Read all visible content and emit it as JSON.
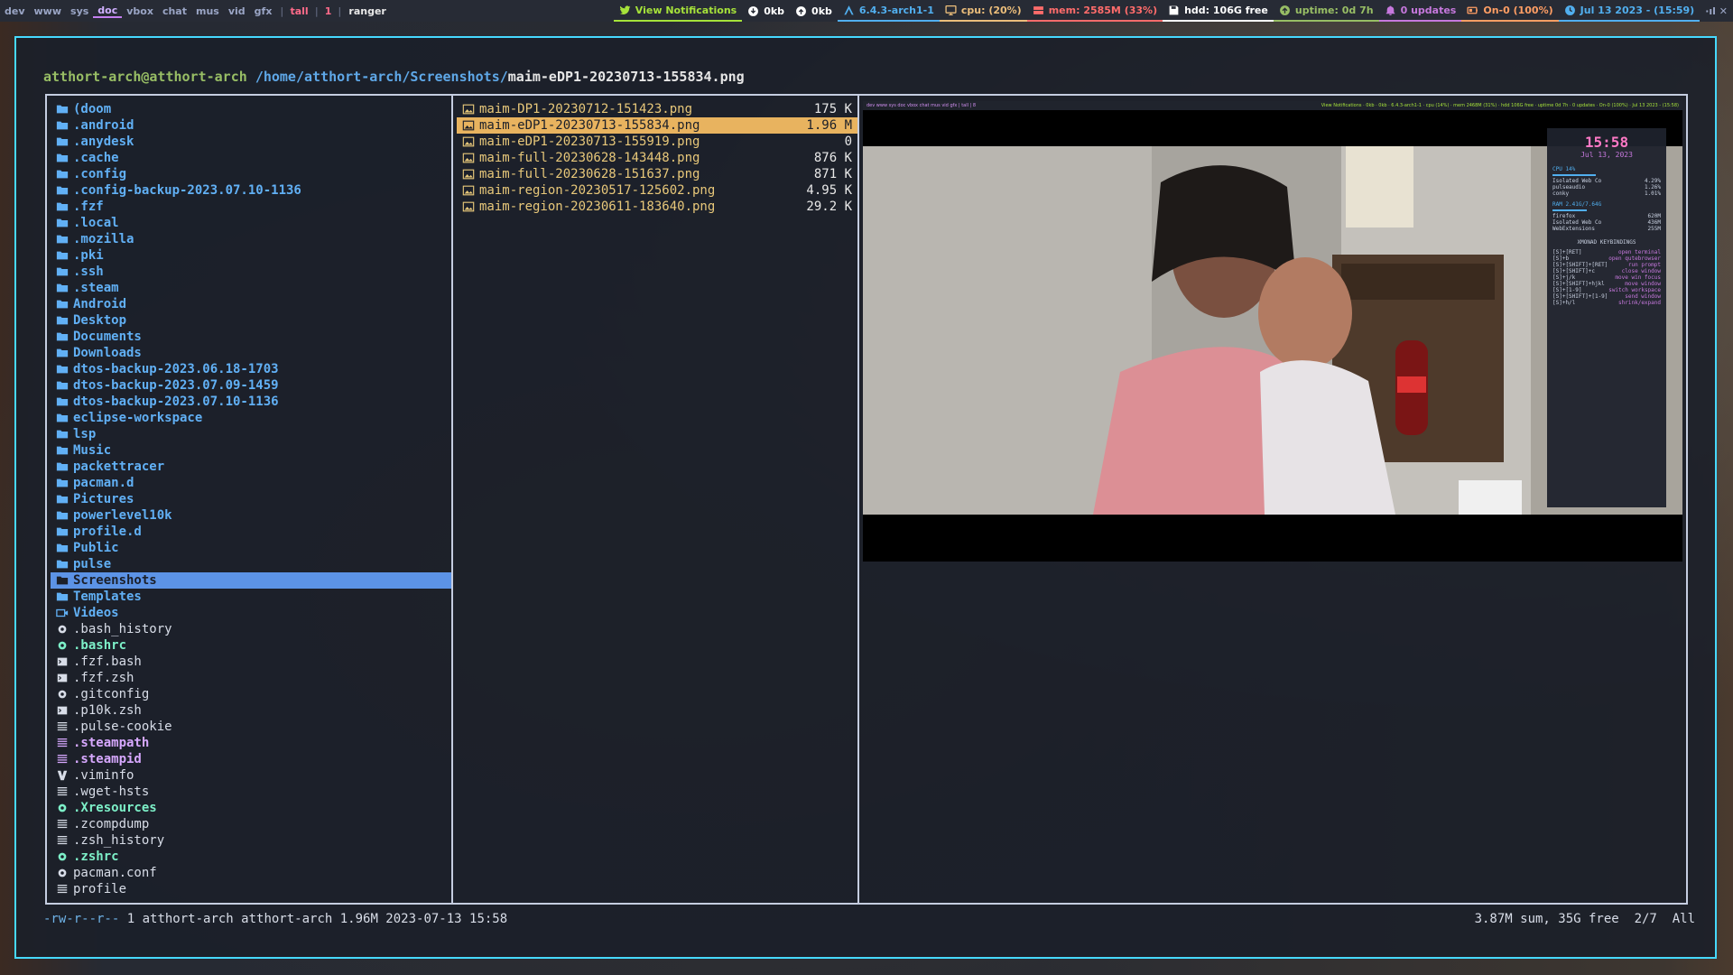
{
  "topbar": {
    "workspaces": [
      "dev",
      "www",
      "sys",
      "doc",
      "vbox",
      "chat",
      "mus",
      "vid",
      "gfx"
    ],
    "layout": "tall",
    "window_count": "1",
    "window_title": "ranger",
    "modules": {
      "notifications": "View Notifications",
      "net_down": "0kb",
      "net_up": "0kb",
      "kernel": "6.4.3-arch1-1",
      "cpu": "cpu: (20%)",
      "mem": "mem: 2585M (33%)",
      "hdd": "hdd: 106G free",
      "uptime": "uptime: 0d 7h",
      "updates": "0 updates",
      "battery": "On-0 (100%)",
      "clock": "Jul 13 2023 - (15:59)"
    },
    "tray": "·ıl ✕"
  },
  "terminal": {
    "host": "atthort-arch@atthort-arch",
    "dir": "/home/atthort-arch/Screenshots/",
    "file": "maim-eDP1-20230713-155834.png"
  },
  "left_pane": [
    {
      "name": "(doom",
      "type": "dir"
    },
    {
      "name": ".android",
      "type": "dir"
    },
    {
      "name": ".anydesk",
      "type": "dir"
    },
    {
      "name": ".cache",
      "type": "dir"
    },
    {
      "name": ".config",
      "type": "dir"
    },
    {
      "name": ".config-backup-2023.07.10-1136",
      "type": "dir"
    },
    {
      "name": ".fzf",
      "type": "dir"
    },
    {
      "name": ".local",
      "type": "dir"
    },
    {
      "name": ".mozilla",
      "type": "dir"
    },
    {
      "name": ".pki",
      "type": "dir"
    },
    {
      "name": ".ssh",
      "type": "dir"
    },
    {
      "name": ".steam",
      "type": "dir"
    },
    {
      "name": "Android",
      "type": "dir"
    },
    {
      "name": "Desktop",
      "type": "dir"
    },
    {
      "name": "Documents",
      "type": "dir"
    },
    {
      "name": "Downloads",
      "type": "dir"
    },
    {
      "name": "dtos-backup-2023.06.18-1703",
      "type": "dir"
    },
    {
      "name": "dtos-backup-2023.07.09-1459",
      "type": "dir"
    },
    {
      "name": "dtos-backup-2023.07.10-1136",
      "type": "dir"
    },
    {
      "name": "eclipse-workspace",
      "type": "dir"
    },
    {
      "name": "lsp",
      "type": "dir"
    },
    {
      "name": "Music",
      "type": "dir"
    },
    {
      "name": "packettracer",
      "type": "dir"
    },
    {
      "name": "pacman.d",
      "type": "dir"
    },
    {
      "name": "Pictures",
      "type": "dir"
    },
    {
      "name": "powerlevel10k",
      "type": "dir"
    },
    {
      "name": "profile.d",
      "type": "dir"
    },
    {
      "name": "Public",
      "type": "dir"
    },
    {
      "name": "pulse",
      "type": "dir"
    },
    {
      "name": "Screenshots",
      "type": "sel"
    },
    {
      "name": "Templates",
      "type": "dir"
    },
    {
      "name": "Videos",
      "type": "video"
    },
    {
      "name": ".bash_history",
      "type": "gear"
    },
    {
      "name": ".bashrc",
      "type": "exec"
    },
    {
      "name": ".fzf.bash",
      "type": "script"
    },
    {
      "name": ".fzf.zsh",
      "type": "script"
    },
    {
      "name": ".gitconfig",
      "type": "gear"
    },
    {
      "name": ".p10k.zsh",
      "type": "script"
    },
    {
      "name": ".pulse-cookie",
      "type": "text"
    },
    {
      "name": ".steampath",
      "type": "link"
    },
    {
      "name": ".steampid",
      "type": "link"
    },
    {
      "name": ".viminfo",
      "type": "vim"
    },
    {
      "name": ".wget-hsts",
      "type": "text"
    },
    {
      "name": ".Xresources",
      "type": "exec"
    },
    {
      "name": ".zcompdump",
      "type": "text"
    },
    {
      "name": ".zsh_history",
      "type": "text"
    },
    {
      "name": ".zshrc",
      "type": "exec"
    },
    {
      "name": "pacman.conf",
      "type": "gear"
    },
    {
      "name": "profile",
      "type": "text"
    }
  ],
  "middle_pane": [
    {
      "name": "maim-DP1-20230712-151423.png",
      "size": "175 K",
      "sel": false
    },
    {
      "name": "maim-eDP1-20230713-155834.png",
      "size": "1.96 M",
      "sel": true
    },
    {
      "name": "maim-eDP1-20230713-155919.png",
      "size": "0",
      "sel": false
    },
    {
      "name": "maim-full-20230628-143448.png",
      "size": "876 K",
      "sel": false
    },
    {
      "name": "maim-full-20230628-151637.png",
      "size": "871 K",
      "sel": false
    },
    {
      "name": "maim-region-20230517-125602.png",
      "size": "4.95 K",
      "sel": false
    },
    {
      "name": "maim-region-20230611-183640.png",
      "size": "29.2 K",
      "sel": false
    }
  ],
  "preview": {
    "conky_time": "15:58",
    "conky_date": "Jul 13, 2023",
    "conky_cpu": "CPU 14%",
    "conky_ram": "RAM 2.41G/7.64G",
    "conky_procs": [
      [
        "Isolated Web Co",
        "4.29%"
      ],
      [
        "pulseaudio",
        "1.26%"
      ],
      [
        "conky",
        "1.01%"
      ]
    ],
    "conky_mem_procs": [
      [
        "firefox",
        "620M"
      ],
      [
        "Isolated Web Co",
        "436M"
      ],
      [
        "WebExtensions",
        "255M"
      ]
    ],
    "conky_kb_title": "XMONAD KEYBINDINGS",
    "conky_kb": [
      [
        "[S]+[RET]",
        "open terminal"
      ],
      [
        "[S]+b",
        "open qutebrowser"
      ],
      [
        "[S]+[SHIFT]+[RET]",
        "run prompt"
      ],
      [
        "[S]+[SHIFT]+c",
        "close window"
      ],
      [
        "[S]+j/k",
        "move win focus"
      ],
      [
        "[S]+[SHIFT]+hjkl",
        "move window"
      ],
      [
        "[S]+[1-9]",
        "switch workspace"
      ],
      [
        "[S]+[SHIFT]+[1-9]",
        "send window"
      ],
      [
        "[S]+h/l",
        "shrink/expand"
      ]
    ]
  },
  "status": {
    "perm": "-rw-r--r--",
    "info": " 1 atthort-arch atthort-arch 1.96M 2023-07-13 15:58",
    "right": "3.87M sum, 35G free  2/7  All"
  }
}
